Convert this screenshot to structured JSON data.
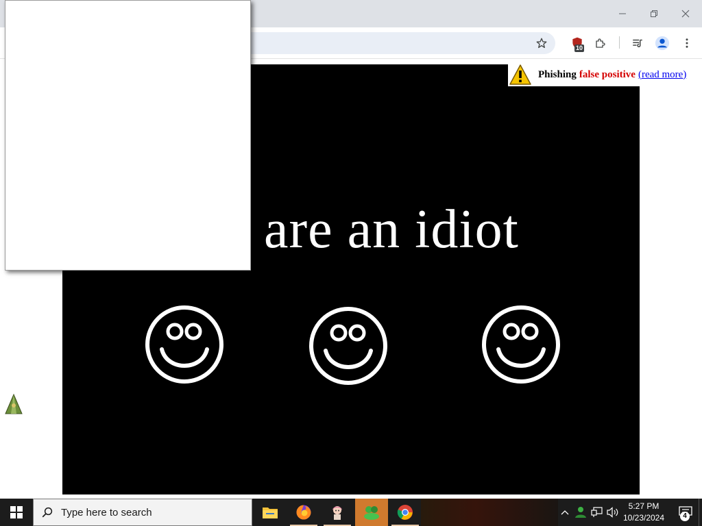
{
  "browser": {
    "window_controls": {
      "minimize_icon": "minimize-icon",
      "restore_icon": "restore-icon",
      "close_icon": "close-icon"
    },
    "toolbar": {
      "bookmark_icon": "star-icon",
      "extension_badge": "10",
      "extensions_icon": "puzzle-icon",
      "media_icon": "media-queue-icon",
      "profile_icon": "profile-icon",
      "menu_icon": "kebab-menu-icon"
    }
  },
  "page": {
    "headline": "are an idiot",
    "warning": {
      "word1": "Phishing",
      "word2": "false positive",
      "link": "(read more)"
    }
  },
  "taskbar": {
    "search_placeholder": "Type here to search",
    "time": "5:27 PM",
    "date": "10/23/2024",
    "notification_count": "4"
  },
  "colors": {
    "warning_red": "#d40000",
    "link_blue": "#0000ee",
    "active_app": "#d07a2e",
    "taskbar_bg": "#1c1c1c"
  }
}
